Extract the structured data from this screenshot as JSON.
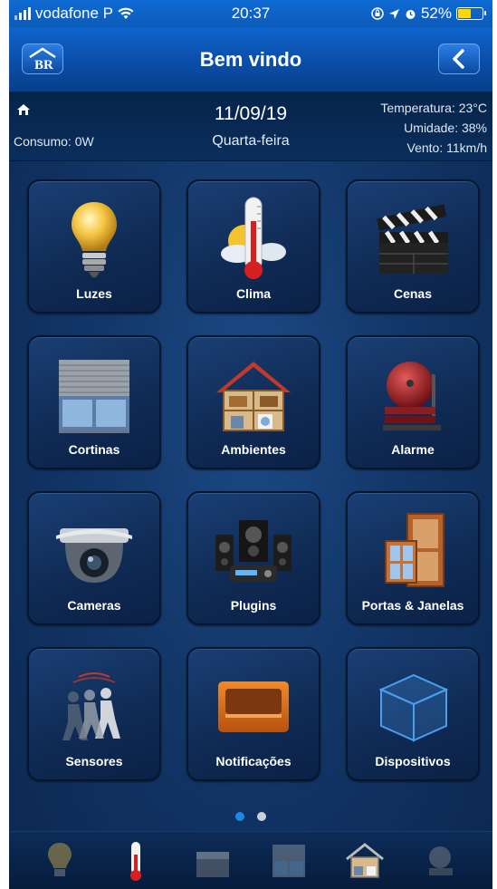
{
  "status_bar": {
    "carrier": "vodafone P",
    "time": "20:37",
    "battery": "52%",
    "battery_level": 0.52
  },
  "header": {
    "title": "Bem vindo"
  },
  "info": {
    "date": "11/09/19",
    "weekday": "Quarta-feira",
    "consumo": "Consumo: 0W",
    "temperatura": "Temperatura: 23°C",
    "umidade": "Umidade: 38%",
    "vento": "Vento: 11km/h"
  },
  "tiles": [
    {
      "label": "Luzes",
      "icon": "light-bulb-icon"
    },
    {
      "label": "Clima",
      "icon": "thermometer-icon"
    },
    {
      "label": "Cenas",
      "icon": "clapperboard-icon"
    },
    {
      "label": "Cortinas",
      "icon": "window-shutter-icon"
    },
    {
      "label": "Ambientes",
      "icon": "house-rooms-icon"
    },
    {
      "label": "Alarme",
      "icon": "alarm-bell-icon"
    },
    {
      "label": "Cameras",
      "icon": "dome-camera-icon"
    },
    {
      "label": "Plugins",
      "icon": "speakers-icon"
    },
    {
      "label": "Portas & Janelas",
      "icon": "door-window-icon"
    },
    {
      "label": "Sensores",
      "icon": "motion-sensor-icon"
    },
    {
      "label": "Notificações",
      "icon": "inbox-tray-icon"
    },
    {
      "label": "Dispositivos",
      "icon": "cube-icon"
    }
  ],
  "pagination": {
    "pages": 2,
    "current": 1
  },
  "colors": {
    "accent": "#0f64cc",
    "dot_active": "#1e88e5",
    "dot_inactive": "#c9d2dc"
  }
}
